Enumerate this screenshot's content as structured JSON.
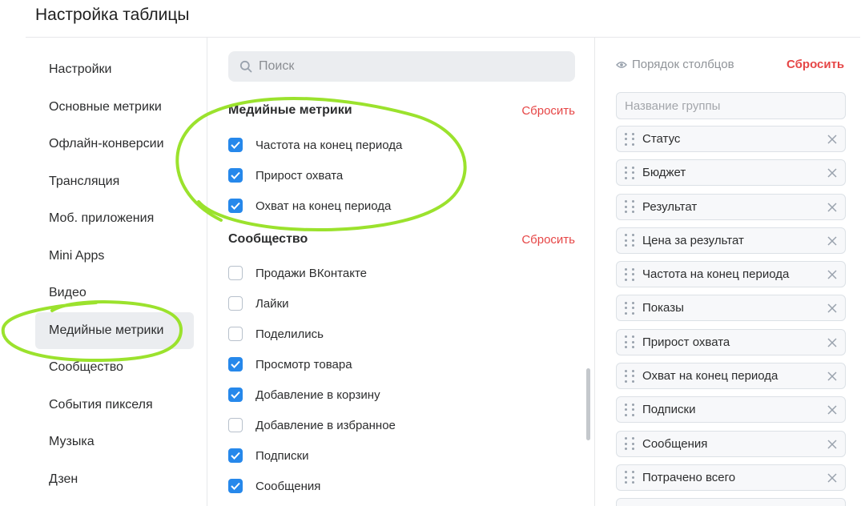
{
  "header": {
    "title": "Настройка таблицы"
  },
  "sidebar": {
    "items": [
      {
        "label": "Настройки",
        "active": false
      },
      {
        "label": "Основные метрики",
        "active": false
      },
      {
        "label": "Офлайн-конверсии",
        "active": false
      },
      {
        "label": "Трансляция",
        "active": false
      },
      {
        "label": "Моб. приложения",
        "active": false
      },
      {
        "label": "Mini Apps",
        "active": false
      },
      {
        "label": "Видео",
        "active": false
      },
      {
        "label": "Медийные метрики",
        "active": true
      },
      {
        "label": "Сообщество",
        "active": false
      },
      {
        "label": "События пикселя",
        "active": false
      },
      {
        "label": "Музыка",
        "active": false
      },
      {
        "label": "Дзен",
        "active": false
      }
    ]
  },
  "search": {
    "placeholder": "Поиск",
    "value": ""
  },
  "sections": [
    {
      "title": "Медийные метрики",
      "reset_label": "Сбросить",
      "items": [
        {
          "label": "Частота на конец периода",
          "checked": true
        },
        {
          "label": "Прирост охвата",
          "checked": true
        },
        {
          "label": "Охват на конец периода",
          "checked": true
        }
      ]
    },
    {
      "title": "Сообщество",
      "reset_label": "Сбросить",
      "items": [
        {
          "label": "Продажи ВКонтакте",
          "checked": false
        },
        {
          "label": "Лайки",
          "checked": false
        },
        {
          "label": "Поделились",
          "checked": false
        },
        {
          "label": "Просмотр товара",
          "checked": true
        },
        {
          "label": "Добавление в корзину",
          "checked": true
        },
        {
          "label": "Добавление в избранное",
          "checked": false
        },
        {
          "label": "Подписки",
          "checked": true
        },
        {
          "label": "Сообщения",
          "checked": true
        }
      ]
    }
  ],
  "column_order": {
    "title": "Порядок столбцов",
    "reset_label": "Сбросить",
    "group_placeholder": "Название группы",
    "items": [
      "Статус",
      "Бюджет",
      "Результат",
      "Цена за результат",
      "Частота на конец периода",
      "Показы",
      "Прирост охвата",
      "Охват на конец периода",
      "Подписки",
      "Сообщения",
      "Потрачено всего"
    ]
  },
  "colors": {
    "accent": "#2688eb",
    "danger": "#e64646",
    "annotation": "#9be22d"
  },
  "icons": {
    "search": "search-icon",
    "eye": "eye-icon",
    "drag": "drag-handle-icon",
    "close": "close-icon",
    "check": "check-icon"
  }
}
